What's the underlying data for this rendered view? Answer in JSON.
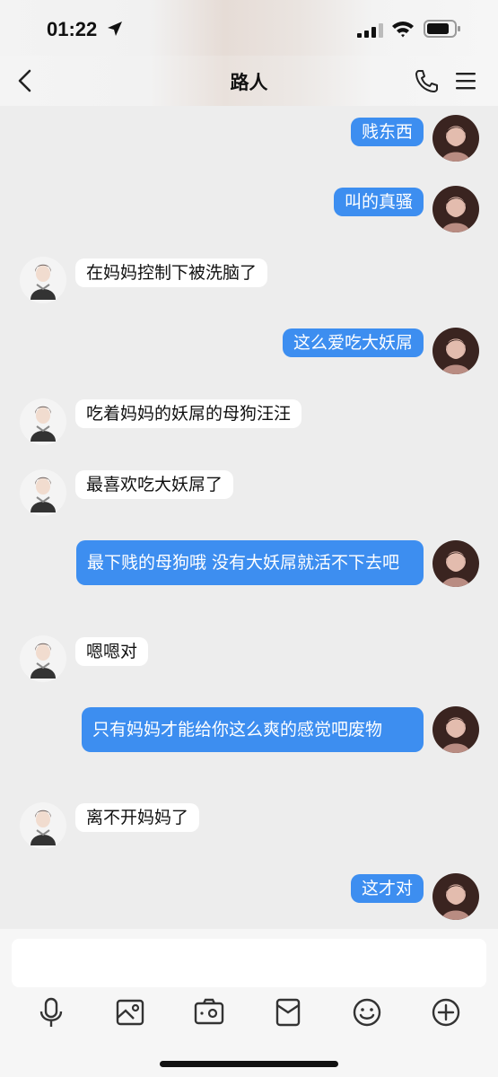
{
  "status_bar": {
    "time": "01:22"
  },
  "header": {
    "title": "路人"
  },
  "messages": [
    {
      "side": "out",
      "text": "贱东西"
    },
    {
      "side": "out",
      "text": "叫的真骚"
    },
    {
      "side": "in",
      "text": "在妈妈控制下被洗脑了"
    },
    {
      "side": "out",
      "text": "这么爱吃大妖屌"
    },
    {
      "side": "in",
      "text": "吃着妈妈的妖屌的母狗汪汪"
    },
    {
      "side": "in",
      "text": "最喜欢吃大妖屌了"
    },
    {
      "side": "out",
      "text": "最下贱的母狗哦 没有大妖屌就活不下去吧"
    },
    {
      "side": "in",
      "text": "嗯嗯对"
    },
    {
      "side": "out",
      "text": "只有妈妈才能给你这么爽的感觉吧废物"
    },
    {
      "side": "in",
      "text": "离不开妈妈了"
    },
    {
      "side": "out",
      "text": "这才对"
    }
  ],
  "input": {
    "value": "",
    "placeholder": ""
  },
  "toolbar": {
    "icons": [
      "microphone-icon",
      "image-icon",
      "camera-icon",
      "red-packet-icon",
      "emoji-icon",
      "plus-icon"
    ]
  },
  "colors": {
    "outgoing_bubble": "#3d8ef0",
    "incoming_bubble": "#ffffff",
    "chat_background": "#ededed"
  }
}
